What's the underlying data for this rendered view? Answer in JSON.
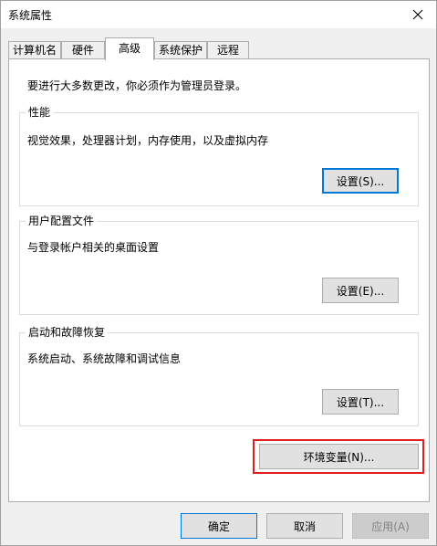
{
  "window": {
    "title": "系统属性"
  },
  "tabs": [
    {
      "label": "计算机名",
      "active": false
    },
    {
      "label": "硬件",
      "active": false
    },
    {
      "label": "高级",
      "active": true
    },
    {
      "label": "系统保护",
      "active": false
    },
    {
      "label": "远程",
      "active": false
    }
  ],
  "panel": {
    "notice": "要进行大多数更改，你必须作为管理员登录。",
    "groups": [
      {
        "label": "性能",
        "description": "视觉效果，处理器计划，内存使用，以及虚拟内存",
        "button": "设置(S)..."
      },
      {
        "label": "用户配置文件",
        "description": "与登录帐户相关的桌面设置",
        "button": "设置(E)..."
      },
      {
        "label": "启动和故障恢复",
        "description": "系统启动、系统故障和调试信息",
        "button": "设置(T)..."
      }
    ],
    "env_button": "环境变量(N)..."
  },
  "footer": {
    "ok": "确定",
    "cancel": "取消",
    "apply": "应用(A)"
  },
  "colors": {
    "highlight": "#e02020",
    "focus": "#0078d7"
  },
  "icons": {
    "close": "close-icon"
  }
}
